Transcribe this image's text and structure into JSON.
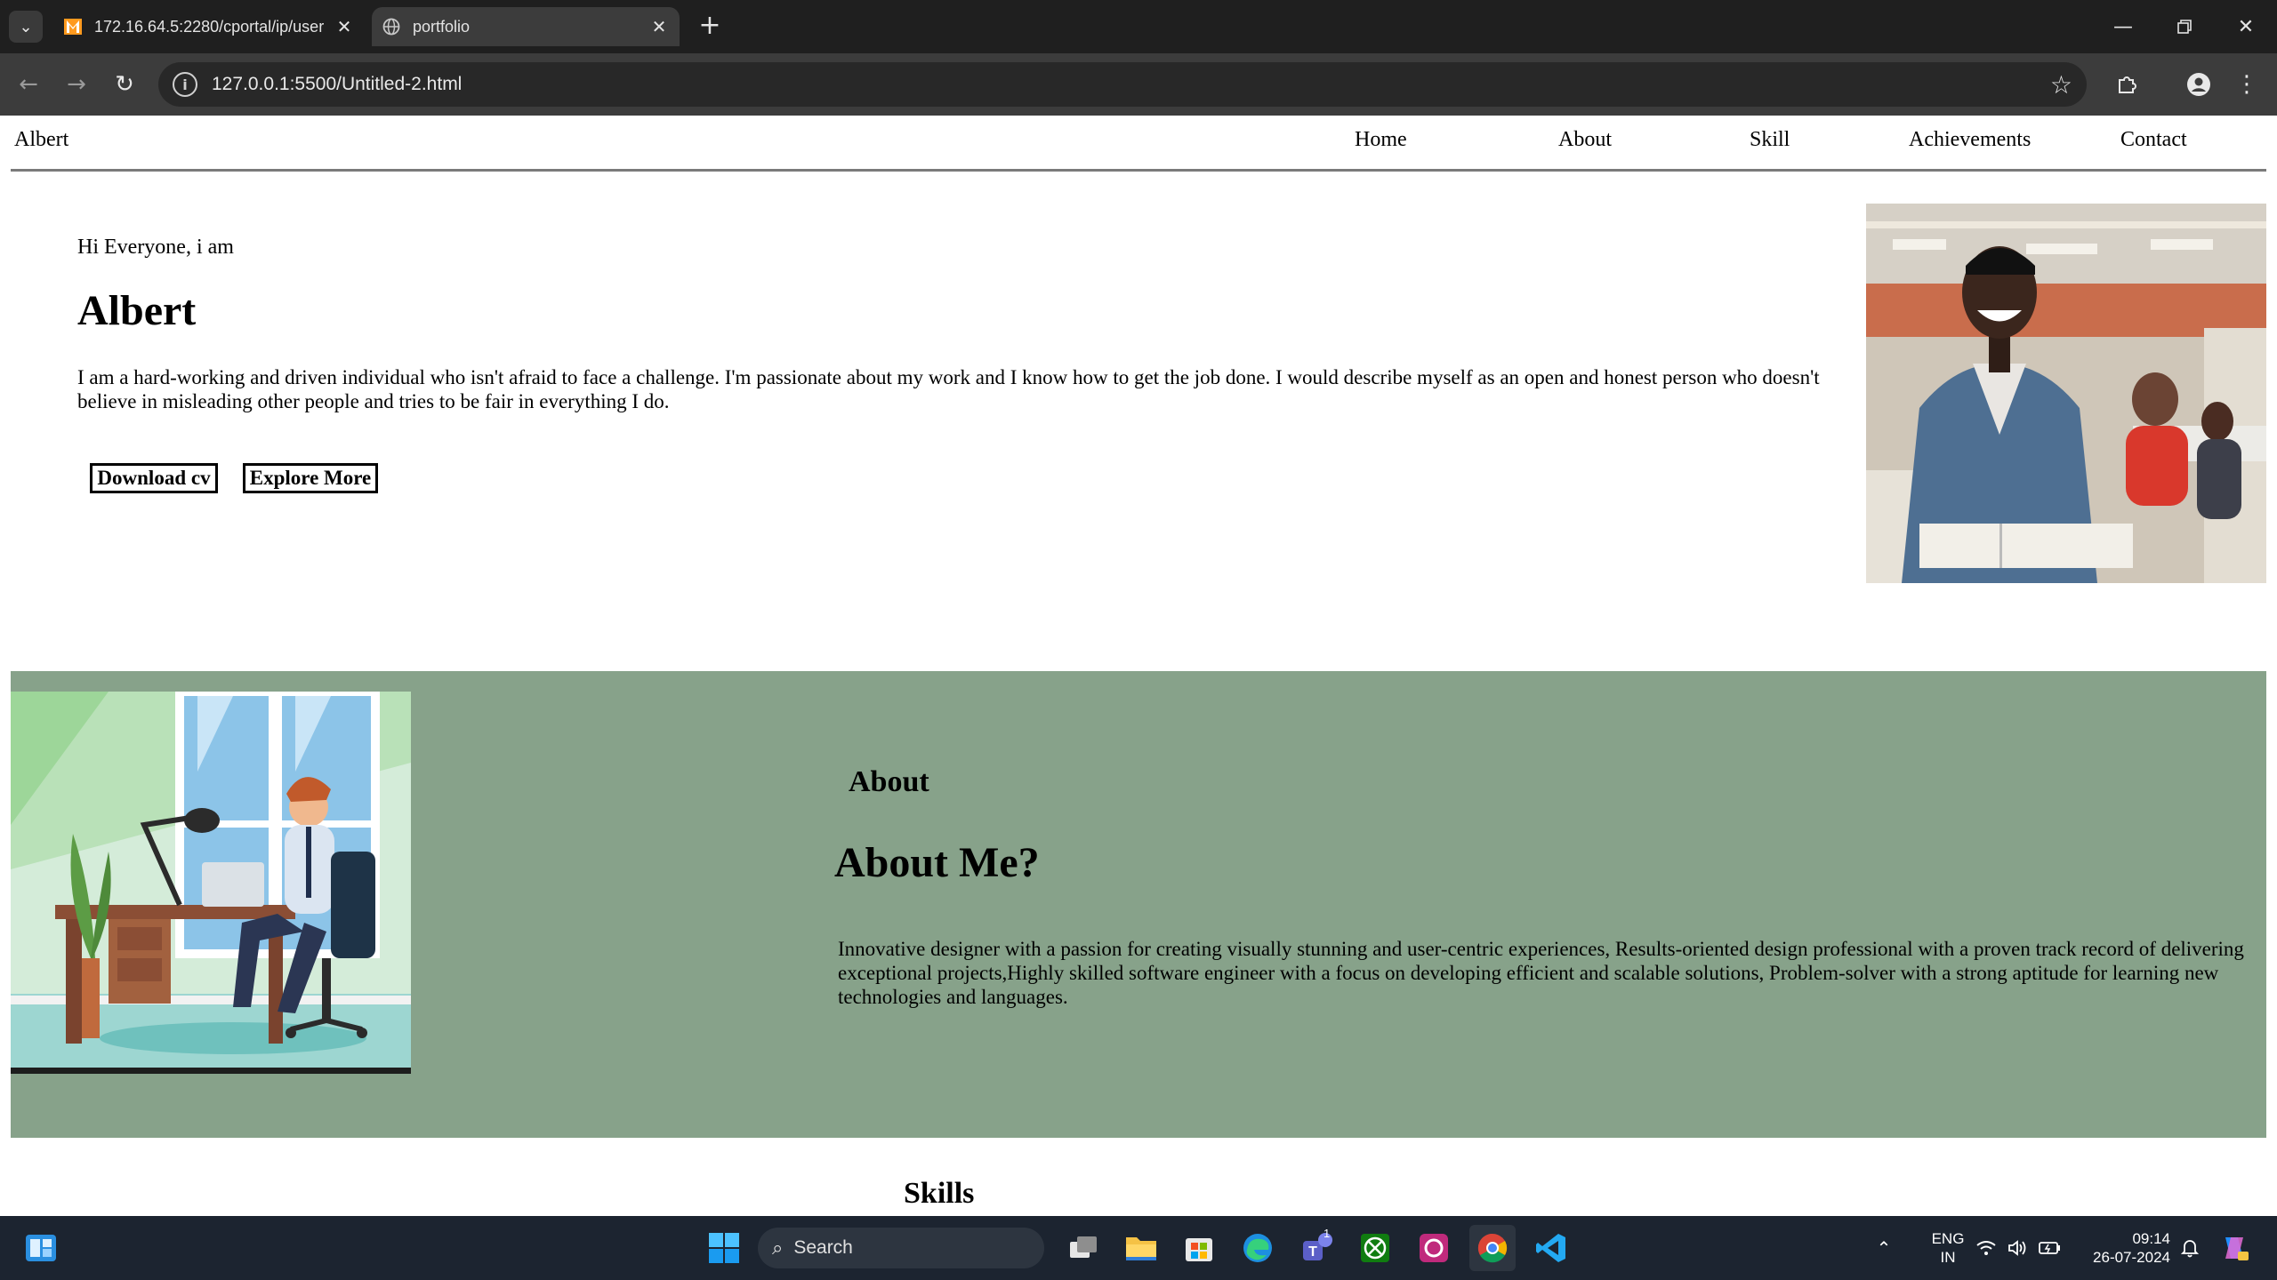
{
  "browser": {
    "tabs": [
      {
        "title": "172.16.64.5:2280/cportal/ip/user",
        "active": false
      },
      {
        "title": "portfolio",
        "active": true
      }
    ],
    "url": "127.0.0.1:5500/Untitled-2.html"
  },
  "nav": {
    "brand": "Albert",
    "links": [
      "Home",
      "About",
      "Skill",
      "Achievements",
      "Contact"
    ]
  },
  "hero": {
    "greeting": "Hi Everyone, i am",
    "name": "Albert",
    "bio": "I am a hard-working and driven individual who isn't afraid to face a challenge. I'm passionate about my work and I know how to get the job done. I would describe myself as an open and honest person who doesn't believe in misleading other people and tries to be fair in everything I do.",
    "buttons": {
      "download": "Download cv",
      "explore": "Explore More"
    }
  },
  "about": {
    "label": "About",
    "title": "About Me?",
    "text": "Innovative designer with a passion for creating visually stunning and user-centric experiences, Results-oriented design professional with a proven track record of delivering exceptional projects,Highly skilled software engineer with a focus on developing efficient and scalable solutions, Problem-solver with a strong aptitude for learning new technologies and languages.",
    "background_color": "#87a28a"
  },
  "skills": {
    "title": "Skills"
  },
  "taskbar": {
    "search_label": "Search",
    "language": {
      "line1": "ENG",
      "line2": "IN"
    },
    "time": "09:14",
    "date": "26-07-2024",
    "teams_badge": "1"
  }
}
